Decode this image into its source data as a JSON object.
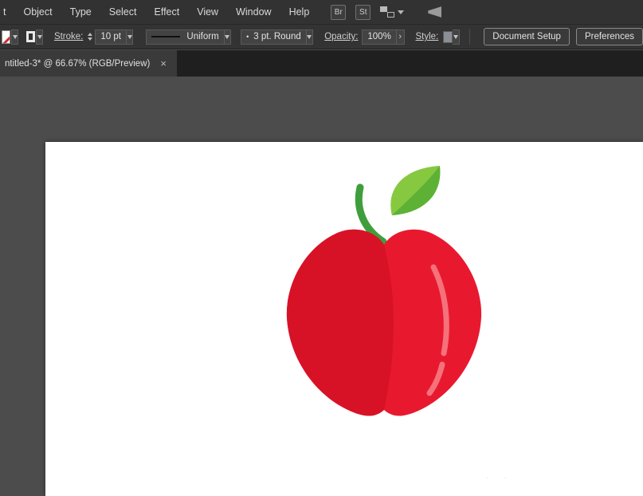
{
  "menu": {
    "items": [
      {
        "label": "t"
      },
      {
        "label": "Object"
      },
      {
        "label": "Type"
      },
      {
        "label": "Select"
      },
      {
        "label": "Effect"
      },
      {
        "label": "View"
      },
      {
        "label": "Window"
      },
      {
        "label": "Help"
      }
    ],
    "br_badge": "Br",
    "st_badge": "St"
  },
  "control_bar": {
    "stroke_label": "Stroke:",
    "stroke_weight": "10 pt",
    "width_profile": "Uniform",
    "brush_dot": "•",
    "brush_name": "3 pt. Round",
    "opacity_label": "Opacity:",
    "opacity_value": "100%",
    "more_arrow": "›",
    "style_label": "Style:",
    "document_setup_label": "Document Setup",
    "preferences_label": "Preferences"
  },
  "tab": {
    "title": "ntitled-3* @ 66.67% (RGB/Preview)",
    "close_glyph": "×"
  },
  "canvas": {
    "watermark": "· ·"
  },
  "artwork": {
    "body_color": "#e8192f",
    "shade_color": "#d81226",
    "highlight_color": "#f5727b",
    "stem_color": "#3f9e3b",
    "leaf_light_color": "#86c940",
    "leaf_dark_color": "#5db235"
  }
}
